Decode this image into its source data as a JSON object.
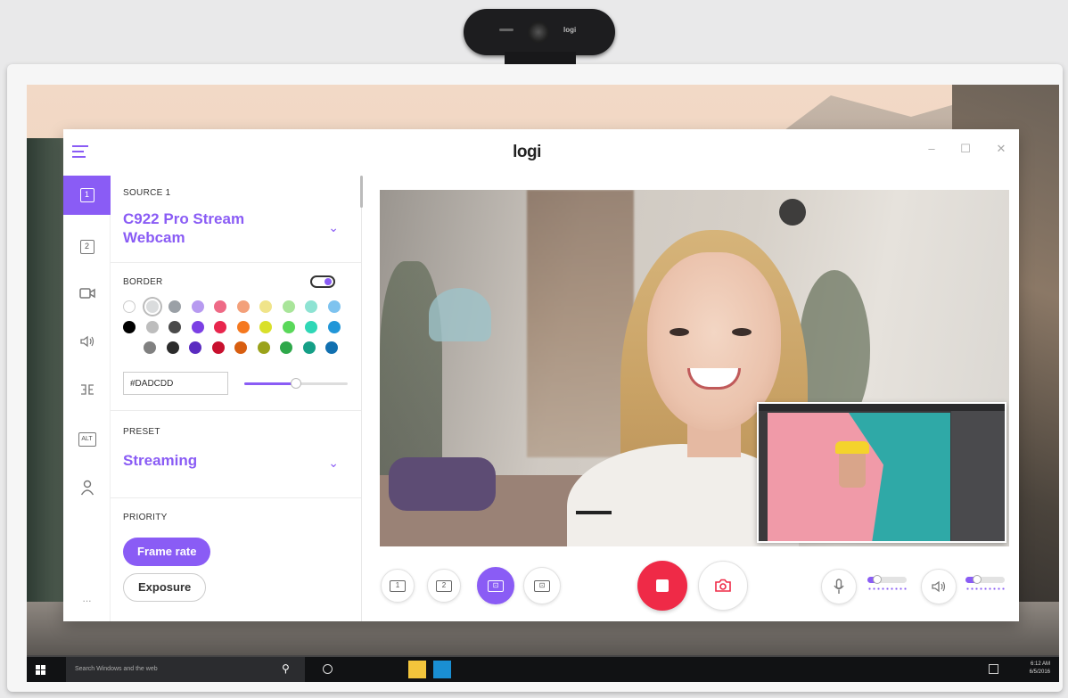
{
  "webcam": {
    "brand": "logi"
  },
  "app": {
    "logo": "logi",
    "window_controls": {
      "minimize": "–",
      "maximize": "☐",
      "close": "✕"
    },
    "rail": [
      {
        "label": "1",
        "icon": "source-1-icon",
        "active": true
      },
      {
        "label": "2",
        "icon": "source-2-icon",
        "active": false
      },
      {
        "label": "",
        "icon": "camera-icon",
        "active": false
      },
      {
        "label": "",
        "icon": "speaker-icon",
        "active": false
      },
      {
        "label": "",
        "icon": "transitions-icon",
        "active": false
      },
      {
        "label": "ALT",
        "icon": "alt-icon",
        "active": false
      },
      {
        "label": "",
        "icon": "user-icon",
        "active": false
      }
    ],
    "more_label": "...",
    "panel": {
      "source_label": "SOURCE 1",
      "source_name": "C922 Pro Stream Webcam",
      "border_label": "BORDER",
      "border_enabled": true,
      "hex_value": "#DADCDD",
      "border_width_fraction": 0.5,
      "swatch_colors": [
        [
          "#ffffff",
          "#dadcdd",
          "#9aa0a6",
          "#b79af0",
          "#ee6a86",
          "#f3a07a",
          "#f0e48a",
          "#a9e59a",
          "#8ee3d3",
          "#7ec3ef"
        ],
        [
          "#000000",
          "#bdbdbd",
          "#4a4a4a",
          "#7b3fe4",
          "#e8264d",
          "#f5781f",
          "#d9e02a",
          "#5ad85a",
          "#2fd7b6",
          "#2196d8"
        ],
        [
          "#808080",
          "#2b2b2b",
          "#5a2bc0",
          "#c8102e",
          "#d85e10",
          "#9aa21a",
          "#2ea84a",
          "#159f86",
          "#1170b0"
        ]
      ],
      "preset_label": "PRESET",
      "preset_value": "Streaming",
      "priority_label": "PRIORITY",
      "priority_options": [
        "Frame rate",
        "Exposure"
      ],
      "priority_selected": "Frame rate"
    },
    "layout_buttons": [
      "1",
      "2",
      "⊡",
      "⊡"
    ],
    "active_layout": 2,
    "mic_level": 0.25,
    "speaker_level": 0.3
  },
  "taskbar": {
    "search_placeholder": "Search Windows and the web",
    "time": "6:12 AM",
    "date": "6/5/2016"
  }
}
